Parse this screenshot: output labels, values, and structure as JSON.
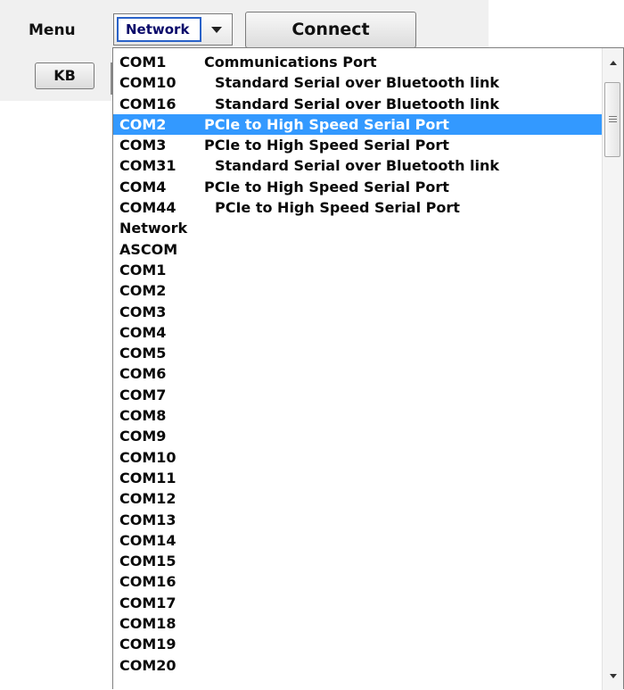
{
  "toolbar": {
    "menu_label": "Menu",
    "port_select_value": "Network",
    "connect_label": "Connect",
    "kb_label": "KB"
  },
  "dropdown": {
    "selected_index": 3,
    "accent_color": "#3399ff",
    "items": [
      {
        "port": "COM1",
        "description": "Communications Port"
      },
      {
        "port": "COM10",
        "description": "Standard Serial over Bluetooth link"
      },
      {
        "port": "COM16",
        "description": "Standard Serial over Bluetooth link"
      },
      {
        "port": "COM2",
        "description": "PCIe to High Speed Serial Port"
      },
      {
        "port": "COM3",
        "description": "PCIe to High Speed Serial Port"
      },
      {
        "port": "COM31",
        "description": "Standard Serial over Bluetooth link"
      },
      {
        "port": "COM4",
        "description": "PCIe to High Speed Serial Port"
      },
      {
        "port": "COM44",
        "description": "PCIe to High Speed Serial Port"
      },
      {
        "port": "Network",
        "description": ""
      },
      {
        "port": "ASCOM",
        "description": ""
      },
      {
        "port": "COM1",
        "description": ""
      },
      {
        "port": "COM2",
        "description": ""
      },
      {
        "port": "COM3",
        "description": ""
      },
      {
        "port": "COM4",
        "description": ""
      },
      {
        "port": "COM5",
        "description": ""
      },
      {
        "port": "COM6",
        "description": ""
      },
      {
        "port": "COM7",
        "description": ""
      },
      {
        "port": "COM8",
        "description": ""
      },
      {
        "port": "COM9",
        "description": ""
      },
      {
        "port": "COM10",
        "description": ""
      },
      {
        "port": "COM11",
        "description": ""
      },
      {
        "port": "COM12",
        "description": ""
      },
      {
        "port": "COM13",
        "description": ""
      },
      {
        "port": "COM14",
        "description": ""
      },
      {
        "port": "COM15",
        "description": ""
      },
      {
        "port": "COM16",
        "description": ""
      },
      {
        "port": "COM17",
        "description": ""
      },
      {
        "port": "COM18",
        "description": ""
      },
      {
        "port": "COM19",
        "description": ""
      },
      {
        "port": "COM20",
        "description": ""
      }
    ]
  },
  "icons": {
    "select_arrow": "chevron-down-icon",
    "scroll_up": "scroll-up-arrow-icon",
    "scroll_down": "scroll-down-arrow-icon",
    "scroll_grip": "grip-icon"
  }
}
